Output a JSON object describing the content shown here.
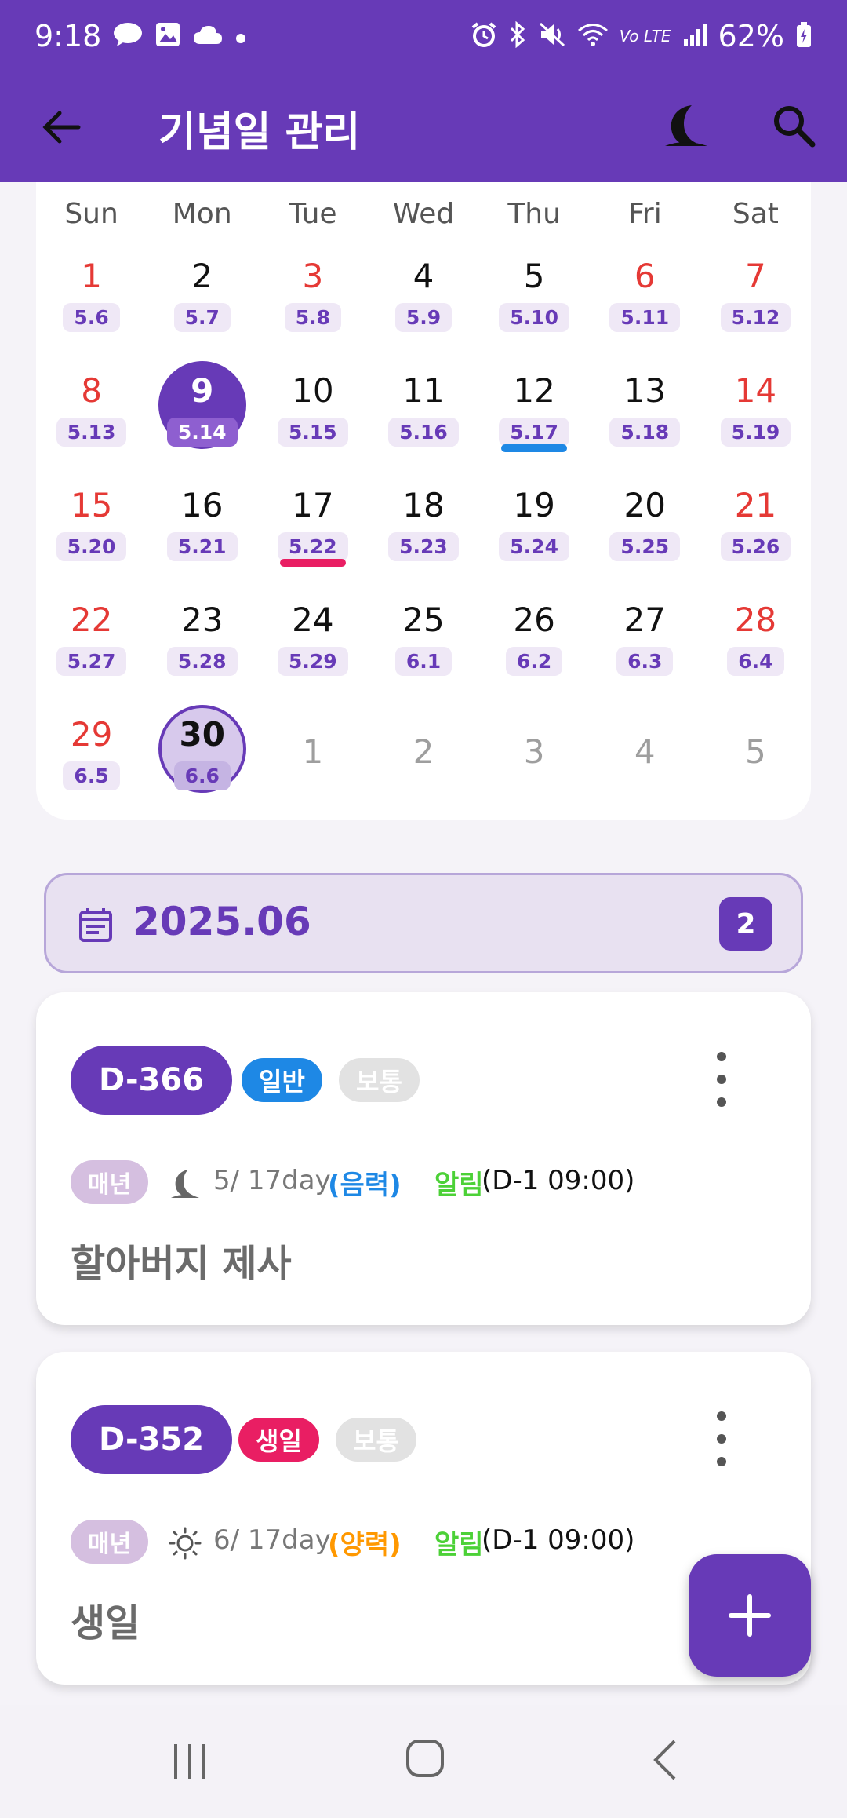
{
  "status_bar": {
    "time": "9:18",
    "battery": "62%",
    "left_icons": [
      "talk-icon",
      "image-icon",
      "cloud-icon",
      "dot-icon"
    ],
    "right_icons": [
      "alarm-icon",
      "bluetooth-icon",
      "mute-icon",
      "wifi-icon",
      "volte-icon",
      "signal-icon",
      "battery-icon"
    ],
    "volte_label": "Vo LTE"
  },
  "app_bar": {
    "title": "기념일 관리",
    "back_icon": "arrow-left-icon",
    "moon_icon": "moon-icon",
    "search_icon": "search-icon"
  },
  "calendar": {
    "weekdays": [
      "Sun",
      "Mon",
      "Tue",
      "Wed",
      "Thu",
      "Fri",
      "Sat"
    ],
    "weeks": [
      [
        {
          "day": "1",
          "lunar": "5.6",
          "red": true
        },
        {
          "day": "2",
          "lunar": "5.7"
        },
        {
          "day": "3",
          "lunar": "5.8",
          "red": true
        },
        {
          "day": "4",
          "lunar": "5.9"
        },
        {
          "day": "5",
          "lunar": "5.10"
        },
        {
          "day": "6",
          "lunar": "5.11",
          "red": true
        },
        {
          "day": "7",
          "lunar": "5.12",
          "red": true
        }
      ],
      [
        {
          "day": "8",
          "lunar": "5.13",
          "red": true
        },
        {
          "day": "9",
          "lunar": "5.14",
          "state": "today"
        },
        {
          "day": "10",
          "lunar": "5.15"
        },
        {
          "day": "11",
          "lunar": "5.16"
        },
        {
          "day": "12",
          "lunar": "5.17",
          "bar": "#1e88e5"
        },
        {
          "day": "13",
          "lunar": "5.18"
        },
        {
          "day": "14",
          "lunar": "5.19",
          "red": true
        }
      ],
      [
        {
          "day": "15",
          "lunar": "5.20",
          "red": true
        },
        {
          "day": "16",
          "lunar": "5.21"
        },
        {
          "day": "17",
          "lunar": "5.22",
          "bar": "#e91e63"
        },
        {
          "day": "18",
          "lunar": "5.23"
        },
        {
          "day": "19",
          "lunar": "5.24"
        },
        {
          "day": "20",
          "lunar": "5.25"
        },
        {
          "day": "21",
          "lunar": "5.26",
          "red": true
        }
      ],
      [
        {
          "day": "22",
          "lunar": "5.27",
          "red": true
        },
        {
          "day": "23",
          "lunar": "5.28"
        },
        {
          "day": "24",
          "lunar": "5.29"
        },
        {
          "day": "25",
          "lunar": "6.1"
        },
        {
          "day": "26",
          "lunar": "6.2"
        },
        {
          "day": "27",
          "lunar": "6.3"
        },
        {
          "day": "28",
          "lunar": "6.4",
          "red": true
        }
      ],
      [
        {
          "day": "29",
          "lunar": "6.5",
          "red": true
        },
        {
          "day": "30",
          "lunar": "6.6",
          "state": "selected"
        },
        {
          "day": "1",
          "other_month": true
        },
        {
          "day": "2",
          "other_month": true
        },
        {
          "day": "3",
          "other_month": true
        },
        {
          "day": "4",
          "other_month": true
        },
        {
          "day": "5",
          "other_month": true
        }
      ]
    ]
  },
  "month_section": {
    "title": "2025.06",
    "count": "2",
    "icon": "calendar-event-icon"
  },
  "events": [
    {
      "dday": "D-366",
      "category": "일반",
      "category_color": "#1e88e5",
      "priority": "보통",
      "repeat": "매년",
      "calendar_icon": "moon-icon",
      "date": "5/ 17day",
      "calendar_type": "(음력)",
      "calendar_type_color": "#1e88e5",
      "alarm_label": "알림",
      "alarm_time": "(D-1 09:00)",
      "title": "할아버지 제사"
    },
    {
      "dday": "D-352",
      "category": "생일",
      "category_color": "#e91e63",
      "priority": "보통",
      "repeat": "매년",
      "calendar_icon": "sun-icon",
      "date": "6/ 17day",
      "calendar_type": "(양력)",
      "calendar_type_color": "#ff9800",
      "alarm_label": "알림",
      "alarm_time": "(D-1 09:00)",
      "title": "생일"
    }
  ],
  "fab": {
    "icon": "plus-icon"
  },
  "nav_bar": {
    "recent_icon": "recent-apps-icon",
    "home_icon": "home-icon",
    "back_icon": "back-icon"
  },
  "colors": {
    "primary": "#673ab7",
    "weekend_red": "#e53935",
    "alarm_green": "#4cd137"
  }
}
